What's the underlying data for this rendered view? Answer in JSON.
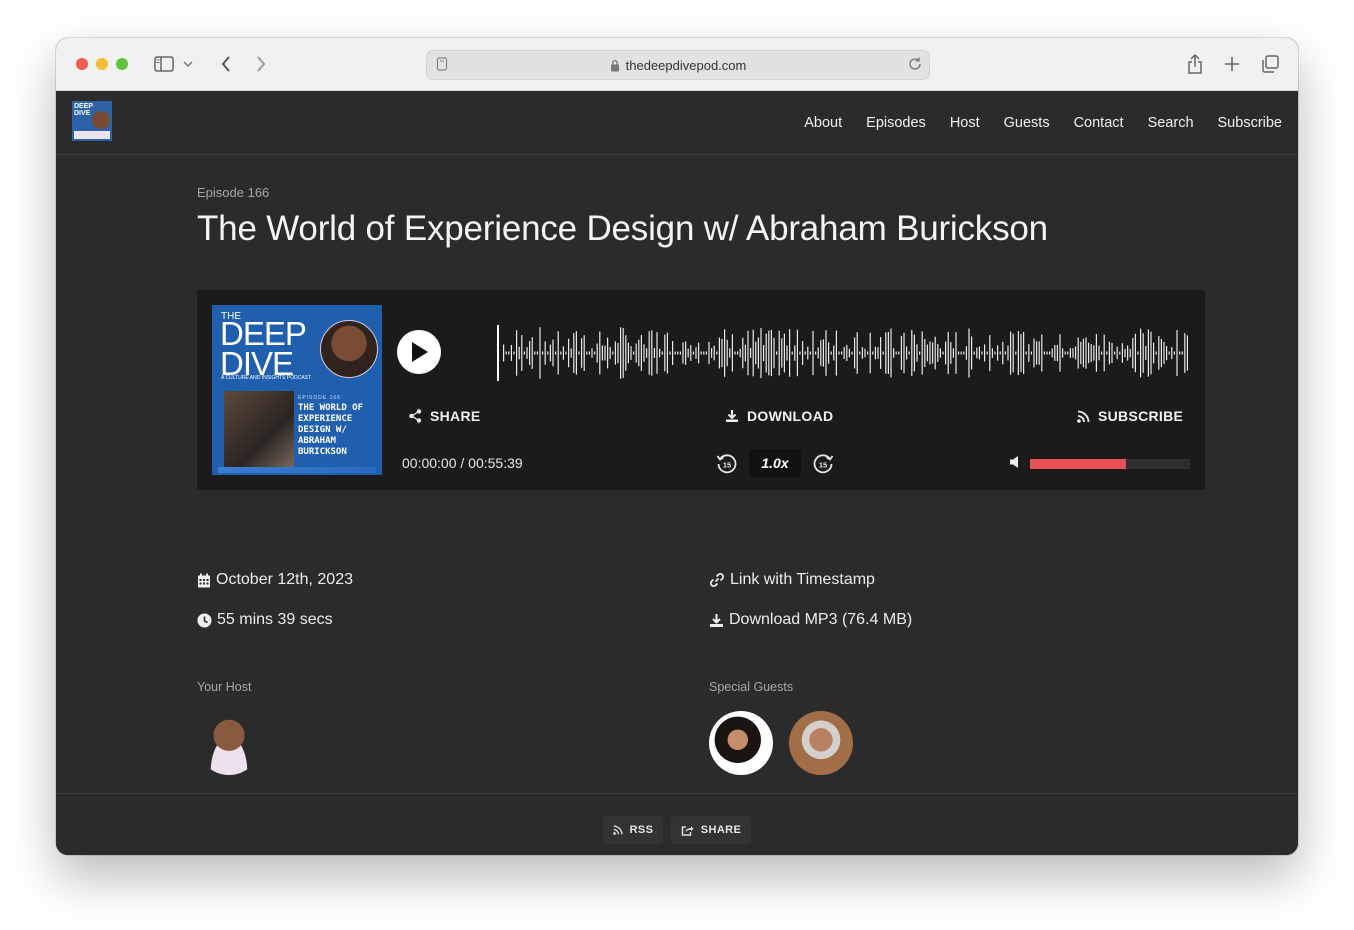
{
  "browser": {
    "url": "thedeepdivepod.com"
  },
  "nav": {
    "links": [
      "About",
      "Episodes",
      "Host",
      "Guests",
      "Contact",
      "Search",
      "Subscribe"
    ]
  },
  "episode": {
    "number": "Episode 166",
    "title": "The World of Experience Design w/ Abraham Burickson"
  },
  "cover": {
    "the": "THE",
    "name": "DEEP DIVE",
    "tagline": "A CULTURE AND INSIGHTS PODCAST",
    "episode_label": "EPISODE 166",
    "episode_title": "THE WORLD OF EXPERIENCE DESIGN W/ ABRAHAM BURICKSON"
  },
  "player": {
    "share_label": "SHARE",
    "download_label": "DOWNLOAD",
    "subscribe_label": "SUBSCRIBE",
    "time": "00:00:00 / 00:55:39",
    "speed": "1.0x",
    "skip_back": "15",
    "skip_forward": "15",
    "volume_level": 0.6,
    "accent_color": "#e85252"
  },
  "meta": {
    "date": "October 12th, 2023",
    "duration": "55 mins 39 secs",
    "link": "Link with Timestamp",
    "download": "Download MP3 (76.4 MB)"
  },
  "people": {
    "host_label": "Your Host",
    "guests_label": "Special Guests"
  },
  "footer": {
    "rss": "RSS",
    "share": "SHARE"
  }
}
